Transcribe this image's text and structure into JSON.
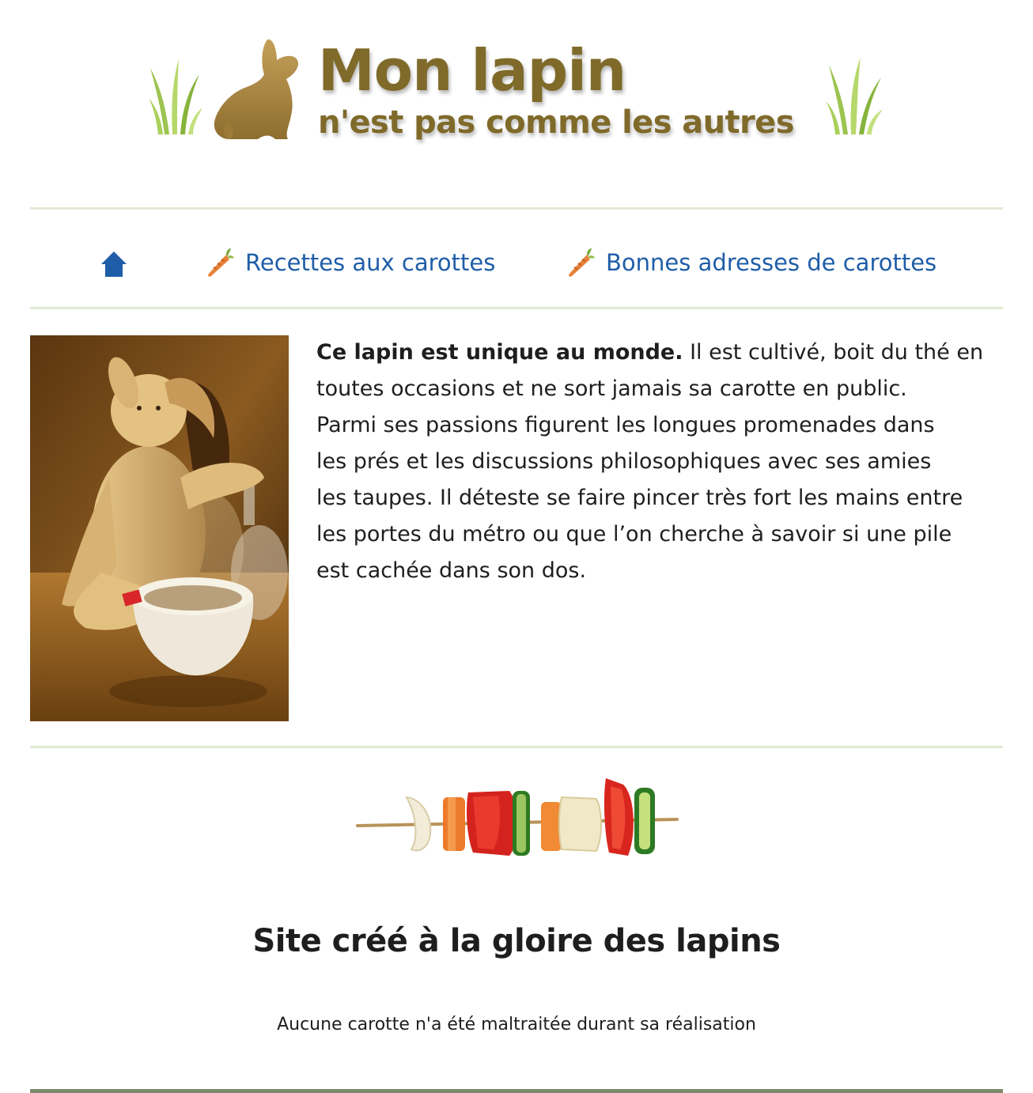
{
  "header": {
    "logo_title": "Mon lapin",
    "logo_subtitle": "n'est pas comme les autres"
  },
  "nav": {
    "items": [
      {
        "label": "Recettes aux carottes",
        "icon": "carrot-icon"
      },
      {
        "label": "Bonnes adresses de carottes",
        "icon": "carrot-icon"
      }
    ],
    "home_icon": "home-icon"
  },
  "content": {
    "intro_bold": "Ce lapin est unique au monde.",
    "intro_lines": [
      " Il est cultivé, boit du thé en",
      "toutes occasions et ne sort jamais sa carotte en public.",
      "Parmi ses passions figurent les longues promenades dans",
      "les prés et les discussions philosophiques avec ses amies",
      "les taupes. Il déteste se faire pincer très fort les mains entre",
      "les portes du métro ou que l’on cherche à savoir si une pile",
      "est cachée dans son dos."
    ]
  },
  "footer": {
    "title": "Site créé à la gloire des lapins",
    "note": "Aucune carotte n'a été maltraitée durant sa réalisation"
  },
  "colors": {
    "link": "#1f5da8",
    "logo_gold": "#7f6a2a",
    "separator": "#e1ead4",
    "carrot": "#e8823a",
    "home": "#1f5da8"
  }
}
